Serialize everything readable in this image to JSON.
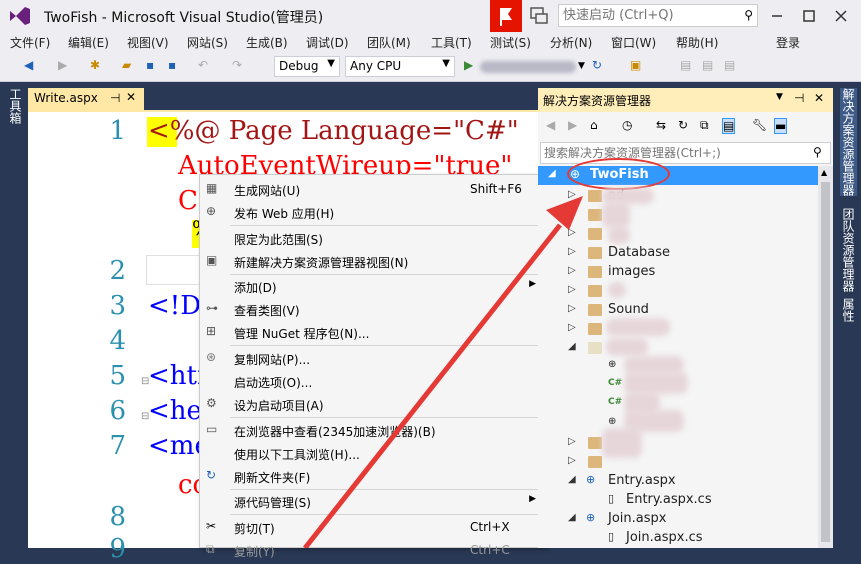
{
  "window": {
    "title": "TwoFish - Microsoft Visual Studio(管理员)",
    "quick_launch_placeholder": "快速启动 (Ctrl+Q)",
    "login": "登录"
  },
  "menu": [
    "文件(F)",
    "编辑(E)",
    "视图(V)",
    "网站(S)",
    "生成(B)",
    "调试(D)",
    "团队(M)",
    "工具(T)",
    "测试(S)",
    "分析(N)",
    "窗口(W)",
    "帮助(H)"
  ],
  "toolbar": {
    "config": "Debug",
    "platform": "Any CPU"
  },
  "left_tab": "工具箱",
  "right_tabs": [
    "解决方案资源管理器",
    "团队资源管理器",
    "属性"
  ],
  "editor": {
    "tab_label": "Write.aspx",
    "line_numbers": [
      "1",
      "2",
      "3",
      "4",
      "5",
      "6",
      "7",
      "8",
      "9"
    ],
    "line1": "<%@ Page Language=\"C#\"",
    "line1b": "AutoEventWireup=\"true\"",
    "line1c": "Co",
    "line3": "<!DO",
    "line5": "<htm",
    "line6": "<hea",
    "line7": "<met",
    "line7b": "co",
    "percent": "%"
  },
  "context_menu": [
    {
      "label": "生成网站(U)",
      "shortcut": "Shift+F6",
      "icon": "build-icon"
    },
    {
      "label": "发布 Web 应用(H)",
      "shortcut": "",
      "icon": "publish-icon"
    },
    {
      "label": "限定为此范围(S)",
      "shortcut": "",
      "icon": ""
    },
    {
      "label": "新建解决方案资源管理器视图(N)",
      "shortcut": "",
      "icon": "new-view-icon"
    },
    {
      "label": "添加(D)",
      "shortcut": "",
      "icon": "",
      "submenu": true
    },
    {
      "label": "查看类图(V)",
      "shortcut": "",
      "icon": "class-diagram-icon"
    },
    {
      "label": "管理 NuGet 程序包(N)...",
      "shortcut": "",
      "icon": "nuget-icon"
    },
    {
      "label": "复制网站(P)...",
      "shortcut": "",
      "icon": "copy-website-icon"
    },
    {
      "label": "启动选项(O)...",
      "shortcut": "",
      "icon": ""
    },
    {
      "label": "设为启动项目(A)",
      "shortcut": "",
      "icon": "gear-icon"
    },
    {
      "label": "在浏览器中查看(2345加速浏览器)(B)",
      "shortcut": "",
      "icon": "browser-icon"
    },
    {
      "label": "使用以下工具浏览(H)...",
      "shortcut": "",
      "icon": ""
    },
    {
      "label": "刷新文件夹(F)",
      "shortcut": "",
      "icon": "refresh-icon"
    },
    {
      "label": "源代码管理(S)",
      "shortcut": "",
      "icon": "",
      "submenu": true
    },
    {
      "label": "剪切(T)",
      "shortcut": "Ctrl+X",
      "icon": "scissors-icon"
    },
    {
      "label": "复制(Y)",
      "shortcut": "Ctrl+C",
      "icon": "copy-icon"
    }
  ],
  "solution_explorer": {
    "title": "解决方案资源管理器",
    "search_placeholder": "搜索解决方案资源管理器(Ctrl+;)",
    "root": "TwoFish",
    "items": [
      {
        "label": "ad",
        "type": "folder"
      },
      {
        "label": "Database",
        "type": "folder"
      },
      {
        "label": "images",
        "type": "folder"
      },
      {
        "label": "Sound",
        "type": "folder"
      },
      {
        "label": "Entry.aspx",
        "type": "aspx"
      },
      {
        "label": "Entry.aspx.cs",
        "type": "cs"
      },
      {
        "label": "Join.aspx",
        "type": "aspx"
      },
      {
        "label": "Join.aspx.cs",
        "type": "cs"
      }
    ]
  },
  "colors": {
    "accent": "#3399ff",
    "annotation": "#e53935",
    "chrome": "#eeeef2",
    "dark": "#293955"
  }
}
